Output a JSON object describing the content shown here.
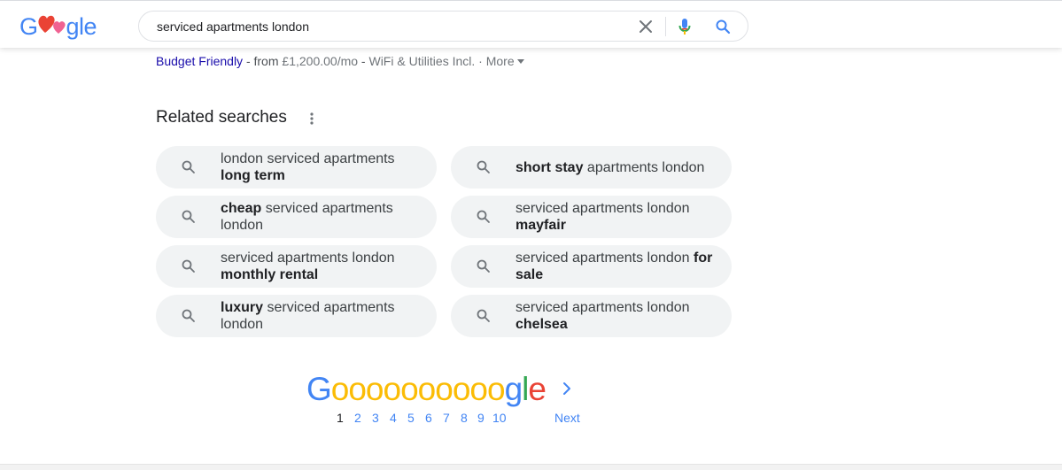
{
  "header": {
    "logo": {
      "text_start": "G",
      "text_end": "gle"
    },
    "search": {
      "query": "serviced apartments london"
    }
  },
  "result_sitelinks": {
    "link_label": "Budget Friendly",
    "separator_1": " - from ",
    "price": "£1,200.00/mo",
    "separator_2": " - ",
    "feature": "WiFi & Utilities Incl.",
    "separator_3": " · ",
    "more_label": "More"
  },
  "related": {
    "title": "Related searches",
    "left": [
      {
        "pre": "london serviced apartments ",
        "bold": "long term",
        "post": ""
      },
      {
        "pre": "",
        "bold": "cheap",
        "post": " serviced apartments london"
      },
      {
        "pre": "serviced apartments london ",
        "bold": "monthly rental",
        "post": ""
      },
      {
        "pre": "",
        "bold": "luxury",
        "post": " serviced apartments london"
      }
    ],
    "right": [
      {
        "pre": "",
        "bold": "short stay",
        "post": " apartments london"
      },
      {
        "pre": "serviced apartments london ",
        "bold": "mayfair",
        "post": ""
      },
      {
        "pre": "serviced apartments london ",
        "bold": "for sale",
        "post": ""
      },
      {
        "pre": "serviced apartments london ",
        "bold": "chelsea",
        "post": ""
      }
    ]
  },
  "pagination": {
    "logo": {
      "G": "G",
      "o": "oooooooooo",
      "g": "g",
      "l": "l",
      "e": "e"
    },
    "pages": [
      "1",
      "2",
      "3",
      "4",
      "5",
      "6",
      "7",
      "8",
      "9",
      "10"
    ],
    "current_page": "1",
    "next_label": "Next"
  },
  "colors": {
    "link": "#1a0dab",
    "chip_bg": "#f1f3f4",
    "google_blue": "#4285f4",
    "google_red": "#ea4335",
    "google_yellow": "#fbbc05",
    "google_green": "#34a853"
  }
}
